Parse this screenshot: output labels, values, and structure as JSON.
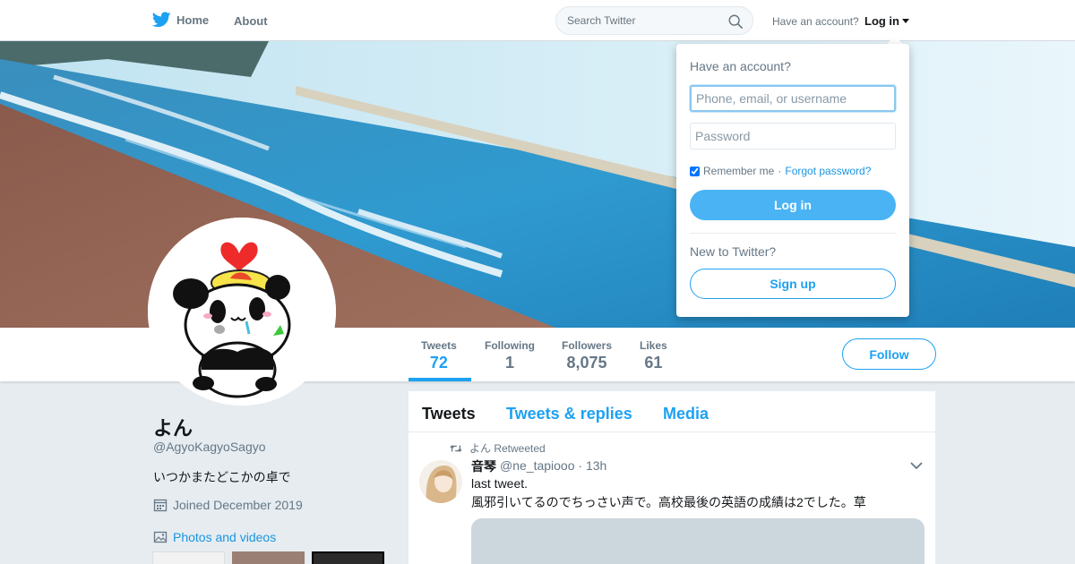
{
  "nav": {
    "home_label": "Home",
    "about_label": "About",
    "search_placeholder": "Search Twitter",
    "have_account": "Have an account?",
    "login_label": "Log in"
  },
  "profile": {
    "name": "よん",
    "handle": "@AgyoKagyoSagyo",
    "bio": "いつかまたどこかの卓で",
    "joined": "Joined December 2019",
    "photos_label": "Photos and videos",
    "follow_label": "Follow"
  },
  "stats": [
    {
      "label": "Tweets",
      "value": "72"
    },
    {
      "label": "Following",
      "value": "1"
    },
    {
      "label": "Followers",
      "value": "8,075"
    },
    {
      "label": "Likes",
      "value": "61"
    }
  ],
  "timeline": {
    "tabs": [
      "Tweets",
      "Tweets & replies",
      "Media"
    ],
    "tweet": {
      "retweet_line": "よん Retweeted",
      "author_name": "音琴",
      "author_meta": "@ne_tapiooo · 13h",
      "text_line1": "last tweet.",
      "text_line2": "風邪引いてるのでちっさい声で。高校最後の英語の成績は2でした。草"
    }
  },
  "login_dropdown": {
    "title": "Have an account?",
    "username_placeholder": "Phone, email, or username",
    "password_placeholder": "Password",
    "remember_label": "Remember me",
    "separator": "·",
    "forgot_label": "Forgot password?",
    "login_button": "Log in",
    "new_label": "New to Twitter?",
    "signup_button": "Sign up"
  },
  "colors": {
    "accent": "#1da1f2",
    "login_button": "#4ab3f4",
    "background": "#e6ecf0"
  },
  "icons": [
    "twitter-bird-icon",
    "search-icon",
    "caret-down-icon",
    "calendar-icon",
    "image-icon",
    "retweet-icon",
    "chevron-down-icon"
  ]
}
